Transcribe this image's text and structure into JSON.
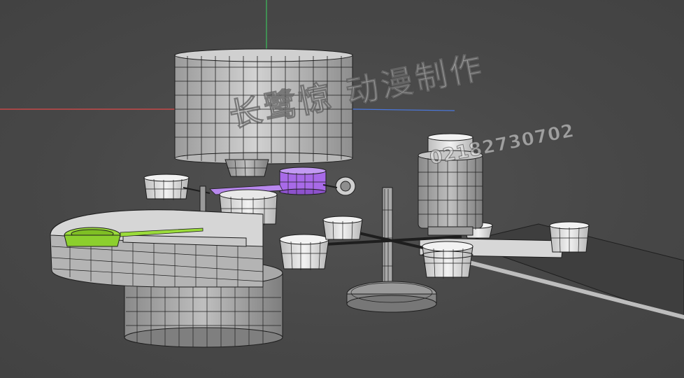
{
  "viewport": {
    "name": "3D Perspective Viewport",
    "background": "#4a4a4a",
    "wire_color": "#1e1e1e",
    "surface_color": "#c9c9c9",
    "selected_color_purple": "#a86ae8",
    "selected_color_green": "#9bdc3a"
  },
  "axes": {
    "x_color": "#e04848",
    "y_color": "#3cbf5c",
    "z_color": "#4a78e0"
  },
  "watermark": {
    "title": "长鹭惊 动漫制作",
    "phone": "02182730702"
  },
  "objects": [
    {
      "name": "large-drum",
      "type": "cylinder"
    },
    {
      "name": "drum-base-cup",
      "type": "cylinder"
    },
    {
      "name": "purple-cup",
      "type": "cylinder",
      "selected": true
    },
    {
      "name": "green-basin",
      "type": "ring",
      "selected": true
    },
    {
      "name": "curved-track",
      "type": "arc"
    },
    {
      "name": "base-cylinder",
      "type": "cylinder"
    },
    {
      "name": "center-pole",
      "type": "cylinder"
    },
    {
      "name": "wheel-base",
      "type": "cylinder"
    },
    {
      "name": "spinner-cups",
      "type": "group"
    },
    {
      "name": "tall-canister",
      "type": "cylinder"
    },
    {
      "name": "conveyor",
      "type": "plane"
    }
  ]
}
